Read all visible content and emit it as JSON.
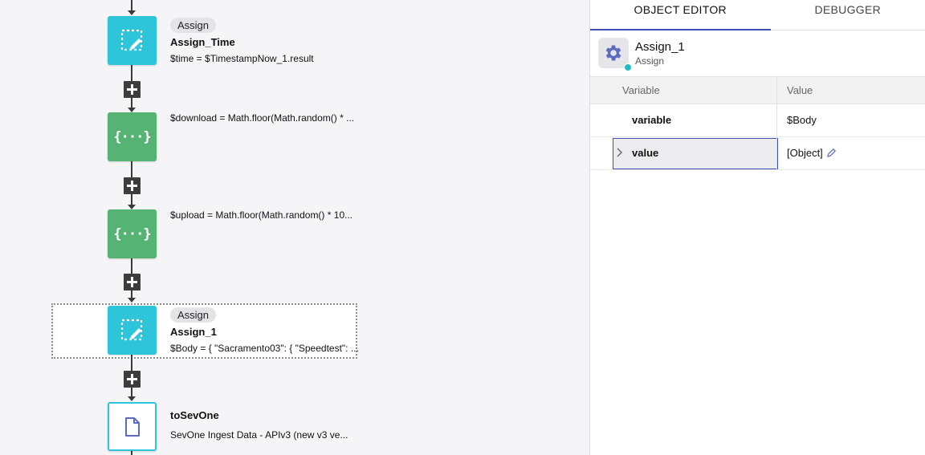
{
  "flow": {
    "add_step_label": "+",
    "nodes": [
      {
        "chip": "Assign",
        "title": "Assign_Time",
        "subtitle": "$time = $TimestampNow_1.result",
        "icon": "assign-icon"
      },
      {
        "chip": "",
        "title": "",
        "subtitle": "$download = Math.floor(Math.random() * ...",
        "icon": "curly-braces-icon",
        "glyph": "{···}"
      },
      {
        "chip": "",
        "title": "",
        "subtitle": "$upload = Math.floor(Math.random() * 10...",
        "icon": "curly-braces-icon",
        "glyph": "{···}"
      },
      {
        "chip": "Assign",
        "title": "Assign_1",
        "subtitle": "$Body = { \"Sacramento03\": { \"Speedtest\": ...",
        "icon": "assign-icon"
      },
      {
        "chip": "",
        "title": "toSevOne",
        "subtitle": "SevOne Ingest Data - APIv3 (new v3 ve...",
        "icon": "document-icon"
      }
    ]
  },
  "panel": {
    "tabs": [
      {
        "label": "OBJECT EDITOR",
        "active": true
      },
      {
        "label": "DEBUGGER",
        "active": false
      }
    ],
    "object": {
      "name": "Assign_1",
      "type": "Assign",
      "icon": "gear-icon",
      "status_color": "#1fbcc8"
    },
    "table": {
      "headers": [
        "Variable",
        "Value"
      ],
      "rows": [
        {
          "name": "variable",
          "value": "$Body"
        },
        {
          "name": "value",
          "value": "[Object]"
        }
      ]
    }
  },
  "colors": {
    "assign": "#2ec4d9",
    "script": "#55b373",
    "accent": "#3f51b5"
  }
}
